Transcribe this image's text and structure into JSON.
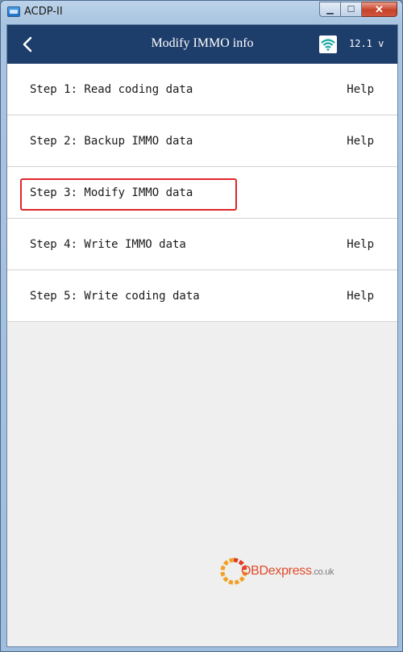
{
  "window": {
    "title": "ACDP-II",
    "minimize_glyph": "▁",
    "maximize_glyph": "☐",
    "close_glyph": "✕"
  },
  "header": {
    "title": "Modify IMMO info",
    "voltage": "12.1 v",
    "back_icon": "chevron-left-icon",
    "wifi_icon": "wifi-icon"
  },
  "steps": [
    {
      "label": "Step 1: Read coding data",
      "help": "Help"
    },
    {
      "label": "Step 2: Backup IMMO data",
      "help": "Help"
    },
    {
      "label": "Step 3: Modify IMMO data",
      "help": ""
    },
    {
      "label": "Step 4: Write IMMO data",
      "help": "Help"
    },
    {
      "label": "Step 5: Write coding data",
      "help": "Help"
    }
  ],
  "highlighted_step": 3,
  "watermark": {
    "brand": "OBDexpress",
    "domain": ".co.uk"
  },
  "colors": {
    "header_bg": "#1d3d6b",
    "highlight": "#e0262b",
    "wifi": "#1aa7a0"
  }
}
